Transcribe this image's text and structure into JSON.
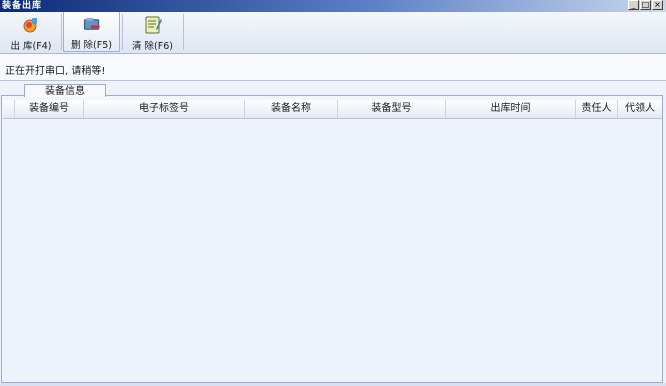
{
  "window": {
    "title": "装备出库",
    "minimize": "_",
    "restore": "□",
    "close": "×"
  },
  "toolbar": {
    "outbound_label": "出 库(F4)",
    "delete_label": "删 除(F5)",
    "clear_label": "清 除(F6)"
  },
  "status": {
    "message": "正在开打串口, 请稍等!"
  },
  "group": {
    "title": "装备信息"
  },
  "table": {
    "columns": [
      "装备编号",
      "电子标签号",
      "装备名称",
      "装备型号",
      "出库时间",
      "责任人",
      "代领人"
    ],
    "rows": []
  }
}
